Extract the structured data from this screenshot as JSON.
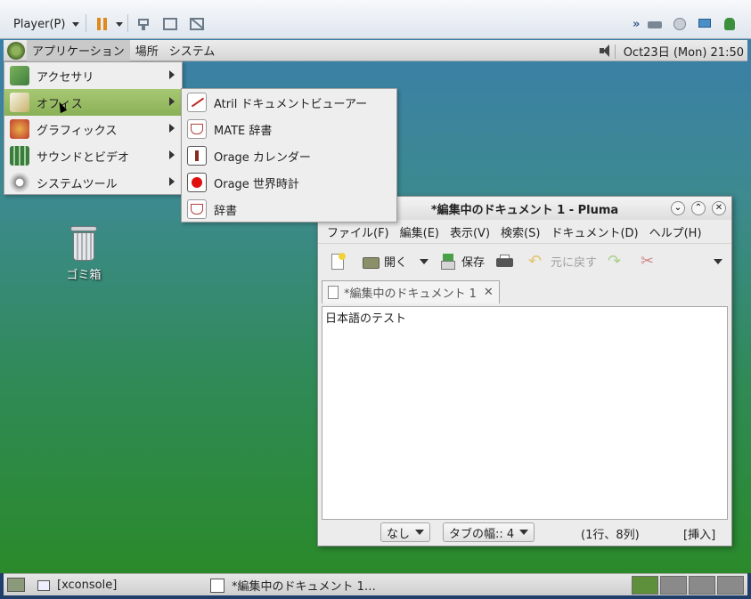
{
  "player_bar": {
    "menu_label": "Player(P)",
    "icons": [
      "pause-icon",
      "send-ctrl-alt-del-icon",
      "fullscreen-icon",
      "unity-icon",
      "devices-icon"
    ]
  },
  "top_panel": {
    "menus": [
      "アプリケーション",
      "場所",
      "システム"
    ],
    "clock": "Oct23日 (Mon) 21:50"
  },
  "apps_menu": {
    "items": [
      {
        "label": "アクセサリ",
        "icon": "accessories-icon"
      },
      {
        "label": "オフィス",
        "icon": "office-icon"
      },
      {
        "label": "グラフィックス",
        "icon": "graphics-icon"
      },
      {
        "label": "サウンドとビデオ",
        "icon": "sound-video-icon"
      },
      {
        "label": "システムツール",
        "icon": "system-tools-icon"
      }
    ]
  },
  "office_menu": {
    "items": [
      {
        "label": "Atril ドキュメントビューアー",
        "icon": "atril-icon"
      },
      {
        "label": "MATE 辞書",
        "icon": "dictionary-icon"
      },
      {
        "label": "Orage カレンダー",
        "icon": "calendar-icon"
      },
      {
        "label": "Orage 世界時計",
        "icon": "globaltime-icon"
      },
      {
        "label": "辞書",
        "icon": "dictionary-icon"
      }
    ]
  },
  "desktop": {
    "trash_label": "ゴミ箱"
  },
  "pluma": {
    "title": "*編集中のドキュメント 1 - Pluma",
    "menubar": [
      "ファイル(F)",
      "編集(E)",
      "表示(V)",
      "検索(S)",
      "ドキュメント(D)",
      "ヘルプ(H)"
    ],
    "toolbar": {
      "open_label": "開く",
      "save_label": "保存",
      "undo_label": "元に戻す"
    },
    "tab_label": "*編集中のドキュメント 1",
    "editor_text": "日本語のテスト",
    "status": {
      "syntax": "なし",
      "tab_width": "タブの幅:: 4",
      "position": "(1行、8列)",
      "mode": "[挿入]"
    }
  },
  "bottom_panel": {
    "tasks": [
      "[xconsole]",
      "*編集中のドキュメント 1…"
    ]
  }
}
